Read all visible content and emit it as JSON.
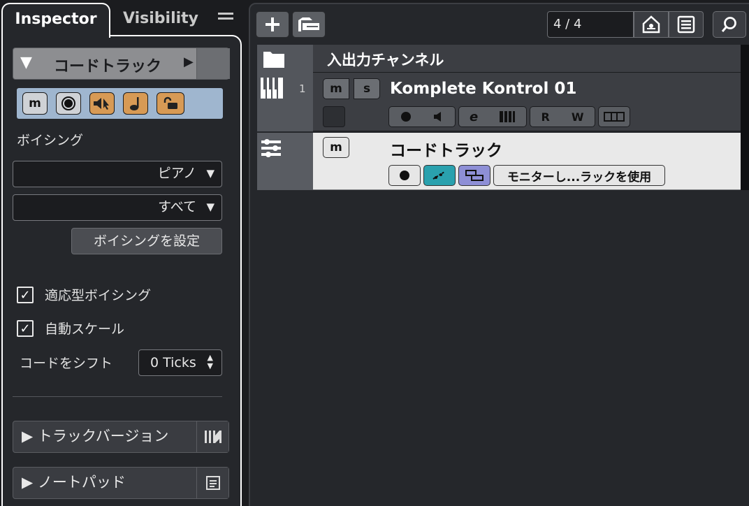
{
  "inspector": {
    "tab_active": "Inspector",
    "tab_inactive": "Visibility",
    "menu_icon": "hamburger-menu-icon",
    "track_header": "コードトラック",
    "buttons": [
      "m",
      "●",
      "speaker-cursor-icon",
      "note-icon",
      "unlock-icon"
    ],
    "voicing_label": "ボイシング",
    "voicing_type": "ピアノ",
    "voicing_scope": "すべて",
    "set_voicing_button": "ボイシングを設定",
    "adaptive_voicing": {
      "label": "適応型ボイシング",
      "checked": true
    },
    "auto_scale": {
      "label": "自動スケール",
      "checked": true
    },
    "shift_chords_label": "コードをシフト",
    "shift_chords_value": "0 Ticks",
    "track_versions_label": "▶ トラックバージョン",
    "notepad_label": "▶ ノートパッド"
  },
  "toolbar": {
    "add_icon": "plus-icon",
    "folder_icon": "folder-add-icon",
    "time_signature": "4 / 4",
    "home_icon": "home-icon",
    "list_icon": "list-icon",
    "search_icon": "search-icon"
  },
  "tracks": [
    {
      "name": "入出力チャンネル",
      "type": "folder"
    },
    {
      "number": "1",
      "name": "Komplete Kontrol 01",
      "type": "instrument",
      "m": "m",
      "s": "s",
      "controls": [
        "●",
        "speaker-icon",
        "e",
        "piano-icon",
        "R",
        "W",
        "lanes-icon"
      ]
    },
    {
      "name": "コードトラック",
      "type": "chord",
      "m": "m",
      "controls": [
        "●",
        "acoustic-feedback-icon",
        "follow-icon"
      ],
      "monitor_label": "モニターし...ラックを使用"
    }
  ],
  "colors": {
    "strip_bg": "#9fb6cf",
    "orange_button": "#d79a55",
    "teal_button": "#2aa1ae",
    "purple_button": "#8e8fd6",
    "chord_row_bg": "#e9e9e9"
  }
}
